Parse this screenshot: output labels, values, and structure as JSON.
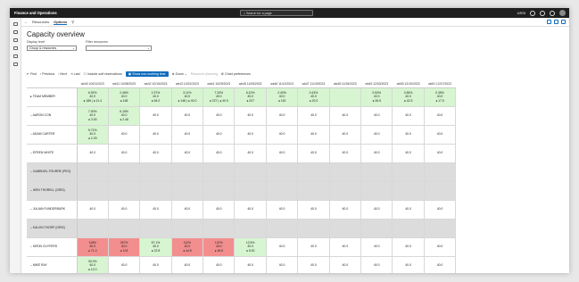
{
  "topbar": {
    "app_name": "Finance and Operations",
    "search_placeholder": "Search for a page",
    "company": "USSI"
  },
  "cmdbar": {
    "back": "←",
    "item1": "Resources",
    "item2": "Options"
  },
  "page": {
    "title": "Capacity overview"
  },
  "filters": {
    "display_label": "Display level",
    "display_value": "Group & resources",
    "filter_label": "Filter resources",
    "filter_value": ""
  },
  "toolbar": {
    "first": "First",
    "previous": "Previous",
    "next": "Next",
    "last": "Last",
    "include_soft": "Include soft reservations",
    "show_non_working": "Show non-working time",
    "zoom": "Zoom",
    "resource_planning": "Resource planning",
    "chart_preferences": "Chart preferences"
  },
  "columns": [
    "wk40 10/01/2023",
    "wk41 10/08/2023",
    "wk42 10/15/2023",
    "wk43 10/22/2023",
    "wk44 10/29/2023",
    "wk45 11/05/2023",
    "wk46 11/12/2023",
    "wk47 11/19/2023",
    "wk48 11/26/2023",
    "wk49 12/03/2023",
    "wk50 12/10/2023",
    "wk51 12/17/2023"
  ],
  "rows": [
    {
      "label": "▸ TEAM MEMBER",
      "type": "data",
      "cells": [
        {
          "t": "6.92%\n40.0\n● 186 | ● 11.4",
          "c": "green"
        },
        {
          "t": "2.46%\n40.0\n● 165",
          "c": "green"
        },
        {
          "t": "1.97%\n40.0\n● 54.0",
          "c": "green"
        },
        {
          "t": "3.11%\n40.0\n● 148 | ● 40.0",
          "c": "green"
        },
        {
          "t": "7.33%\n40.0\n● 227 | ● 40.0",
          "c": "green"
        },
        {
          "t": "6.10%\n40.0\n● 207",
          "c": "green"
        },
        {
          "t": "2.40%\n40.0\n● 115",
          "c": "green"
        },
        {
          "t": "0.43%\n40.0\n● 20.0",
          "c": "green"
        },
        {
          "t": "",
          "c": "green"
        },
        {
          "t": "0.53%\n40.0\n● 26.5",
          "c": "green"
        },
        {
          "t": "0.84%\n40.0\n● 42.5",
          "c": "green"
        },
        {
          "t": "0.35%\n40.0\n● 17.0",
          "c": "green"
        }
      ]
    },
    {
      "label": "– AARON CON",
      "type": "data",
      "cells": [
        {
          "t": "7.00%\n40.0\n● 3.00",
          "c": "green"
        },
        {
          "t": "6.15%\n40.0\n● 2.46",
          "c": "green"
        },
        {
          "t": "40.0",
          "c": ""
        },
        {
          "t": "40.0",
          "c": ""
        },
        {
          "t": "40.0",
          "c": ""
        },
        {
          "t": "40.0",
          "c": ""
        },
        {
          "t": "40.0",
          "c": ""
        },
        {
          "t": "40.0",
          "c": ""
        },
        {
          "t": "40.0",
          "c": ""
        },
        {
          "t": "40.0",
          "c": ""
        },
        {
          "t": "40.0",
          "c": ""
        },
        {
          "t": "40.0",
          "c": ""
        }
      ]
    },
    {
      "label": "– ADAM CARTER",
      "type": "data",
      "cells": [
        {
          "t": "5.71%\n40.0\n● 2.29",
          "c": "green"
        },
        {
          "t": "40.0",
          "c": ""
        },
        {
          "t": "40.0",
          "c": ""
        },
        {
          "t": "40.0",
          "c": ""
        },
        {
          "t": "40.0",
          "c": ""
        },
        {
          "t": "40.0",
          "c": ""
        },
        {
          "t": "40.0",
          "c": ""
        },
        {
          "t": "40.0",
          "c": ""
        },
        {
          "t": "40.0",
          "c": ""
        },
        {
          "t": "40.0",
          "c": ""
        },
        {
          "t": "40.0",
          "c": ""
        },
        {
          "t": "40.0",
          "c": ""
        }
      ]
    },
    {
      "label": "– EFREN WHITE",
      "type": "data",
      "cells": [
        {
          "t": "40.0",
          "c": ""
        },
        {
          "t": "40.0",
          "c": ""
        },
        {
          "t": "40.0",
          "c": ""
        },
        {
          "t": "40.0",
          "c": ""
        },
        {
          "t": "40.0",
          "c": ""
        },
        {
          "t": "40.0",
          "c": ""
        },
        {
          "t": "40.0",
          "c": ""
        },
        {
          "t": "40.0",
          "c": ""
        },
        {
          "t": "40.0",
          "c": ""
        },
        {
          "t": "40.0",
          "c": ""
        },
        {
          "t": "40.0",
          "c": ""
        },
        {
          "t": "40.0",
          "c": ""
        }
      ]
    },
    {
      "label": "– GABRIAEL FOURRE (PEG)",
      "type": "empty",
      "cells": []
    },
    {
      "label": "– IKEN THORELL (GRIS)",
      "type": "empty",
      "cells": []
    },
    {
      "label": "– JULIAN FUNDERBURK",
      "type": "data",
      "cells": [
        {
          "t": "40.0",
          "c": ""
        },
        {
          "t": "40.0",
          "c": ""
        },
        {
          "t": "40.0",
          "c": ""
        },
        {
          "t": "40.0",
          "c": ""
        },
        {
          "t": "40.0",
          "c": ""
        },
        {
          "t": "40.0",
          "c": ""
        },
        {
          "t": "40.0",
          "c": ""
        },
        {
          "t": "40.0",
          "c": ""
        },
        {
          "t": "40.0",
          "c": ""
        },
        {
          "t": "40.0",
          "c": ""
        },
        {
          "t": "40.0",
          "c": ""
        },
        {
          "t": "40.0",
          "c": ""
        }
      ]
    },
    {
      "label": "– KALVIN THORP (GRIS)",
      "type": "empty",
      "cells": []
    },
    {
      "label": "– KEEIN CUYFERS",
      "type": "data",
      "cells": [
        {
          "t": "118%\n40.0\n● 71.0",
          "c": "red"
        },
        {
          "t": "257%\n40.0\n● 103",
          "c": "red"
        },
        {
          "t": "57.1%\n40.0\n● 22.8",
          "c": "green"
        },
        {
          "t": "112%\n40.0\n● 44.8",
          "c": "red"
        },
        {
          "t": "122%\n40.0\n● 48.8",
          "c": "red"
        },
        {
          "t": "12.5%\n40.0\n● 5.00",
          "c": "green"
        },
        {
          "t": "40.0",
          "c": ""
        },
        {
          "t": "40.0",
          "c": ""
        },
        {
          "t": "40.0",
          "c": ""
        },
        {
          "t": "40.0",
          "c": ""
        },
        {
          "t": "40.0",
          "c": ""
        },
        {
          "t": "40.0",
          "c": ""
        }
      ]
    },
    {
      "label": "– MIKE RAY",
      "type": "data",
      "cells": [
        {
          "t": "30.0%\n40.0\n● 12.0",
          "c": "green"
        },
        {
          "t": "40.0",
          "c": ""
        },
        {
          "t": "40.0",
          "c": ""
        },
        {
          "t": "40.0",
          "c": ""
        },
        {
          "t": "40.0",
          "c": ""
        },
        {
          "t": "40.0",
          "c": ""
        },
        {
          "t": "40.0",
          "c": ""
        },
        {
          "t": "40.0",
          "c": ""
        },
        {
          "t": "40.0",
          "c": ""
        },
        {
          "t": "40.0",
          "c": ""
        },
        {
          "t": "40.0",
          "c": ""
        },
        {
          "t": "40.0",
          "c": ""
        }
      ]
    }
  ]
}
